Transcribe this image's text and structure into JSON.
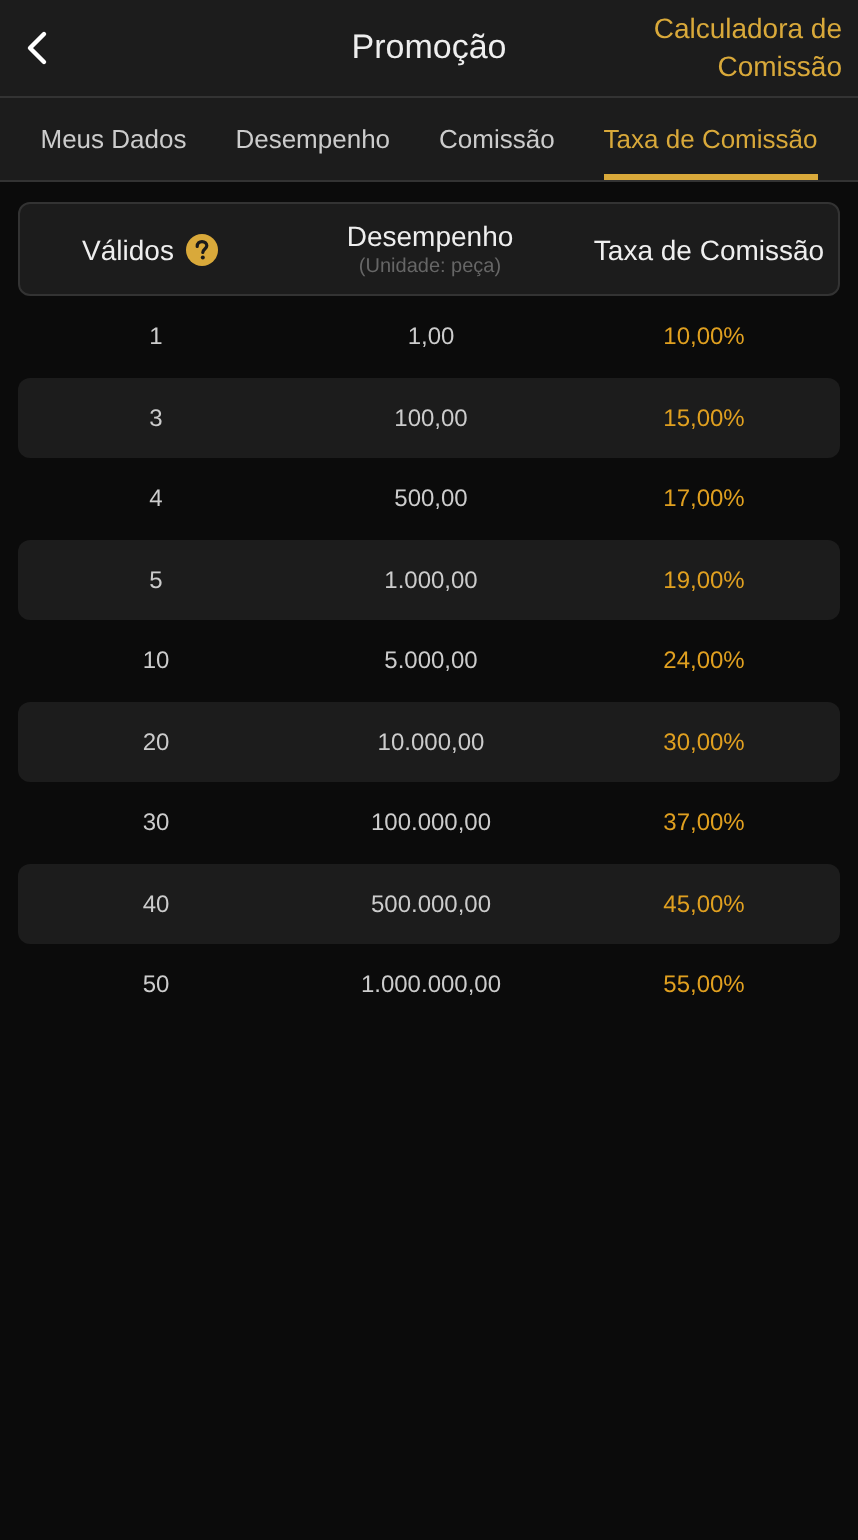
{
  "header": {
    "title": "Promoção",
    "action": "Calculadora de Comissão"
  },
  "tabs": [
    {
      "label": "Meus Dados",
      "selected": false
    },
    {
      "label": "Desempenho",
      "selected": false
    },
    {
      "label": "Comissão",
      "selected": false
    },
    {
      "label": "Taxa de Comissão",
      "selected": true
    }
  ],
  "table": {
    "columns": [
      {
        "label": "Válidos"
      },
      {
        "label": "Desempenho",
        "sublabel": "(Unidade: peça)"
      },
      {
        "label": "Taxa de Comissão"
      }
    ],
    "rows": [
      [
        "1",
        "1,00",
        "10,00%"
      ],
      [
        "3",
        "100,00",
        "15,00%"
      ],
      [
        "4",
        "500,00",
        "17,00%"
      ],
      [
        "5",
        "1.000,00",
        "19,00%"
      ],
      [
        "10",
        "5.000,00",
        "24,00%"
      ],
      [
        "20",
        "10.000,00",
        "30,00%"
      ],
      [
        "30",
        "100.000,00",
        "37,00%"
      ],
      [
        "40",
        "500.000,00",
        "45,00%"
      ],
      [
        "50",
        "1.000.000,00",
        "55,00%"
      ]
    ]
  }
}
